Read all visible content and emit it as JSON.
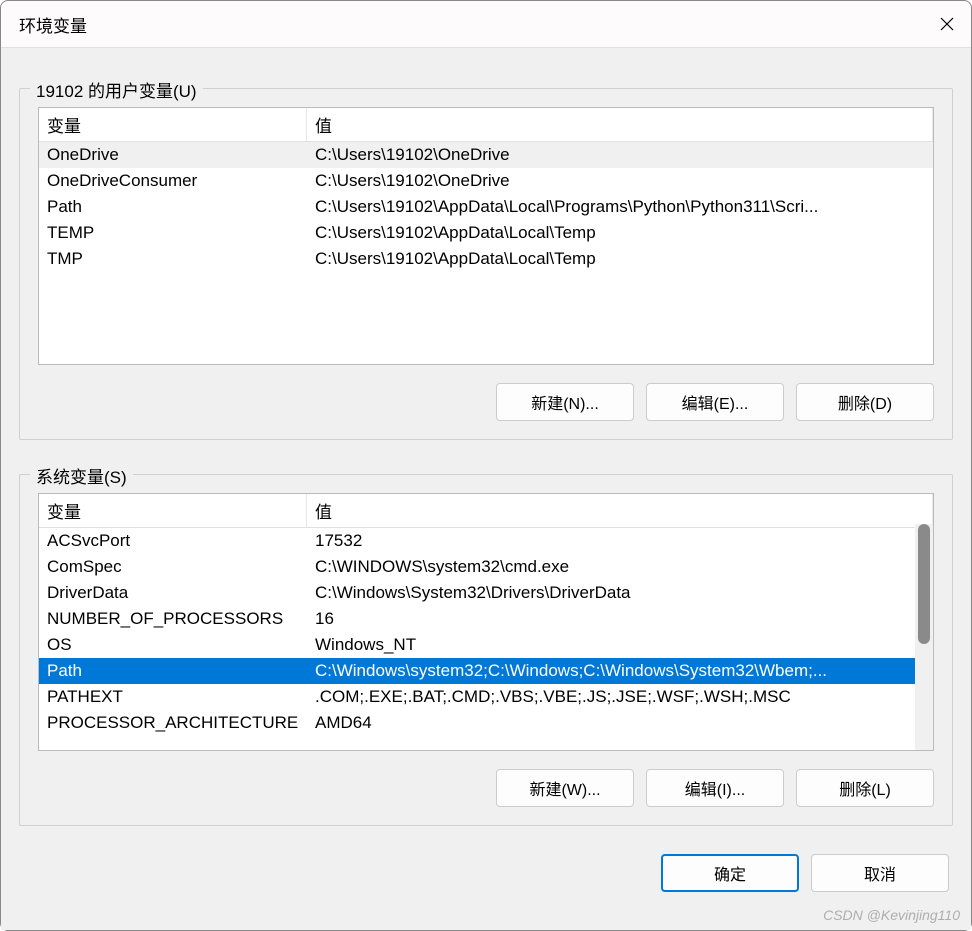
{
  "window": {
    "title": "环境变量"
  },
  "user_vars": {
    "group_label": "19102 的用户变量(U)",
    "columns": {
      "name": "变量",
      "value": "值"
    },
    "rows": [
      {
        "name": "OneDrive",
        "value": "C:\\Users\\19102\\OneDrive",
        "selected": "inactive"
      },
      {
        "name": "OneDriveConsumer",
        "value": "C:\\Users\\19102\\OneDrive"
      },
      {
        "name": "Path",
        "value": "C:\\Users\\19102\\AppData\\Local\\Programs\\Python\\Python311\\Scri..."
      },
      {
        "name": "TEMP",
        "value": "C:\\Users\\19102\\AppData\\Local\\Temp"
      },
      {
        "name": "TMP",
        "value": "C:\\Users\\19102\\AppData\\Local\\Temp"
      }
    ],
    "buttons": {
      "new": "新建(N)...",
      "edit": "编辑(E)...",
      "delete": "删除(D)"
    }
  },
  "system_vars": {
    "group_label": "系统变量(S)",
    "columns": {
      "name": "变量",
      "value": "值"
    },
    "rows": [
      {
        "name": "ACSvcPort",
        "value": "17532"
      },
      {
        "name": "ComSpec",
        "value": "C:\\WINDOWS\\system32\\cmd.exe"
      },
      {
        "name": "DriverData",
        "value": "C:\\Windows\\System32\\Drivers\\DriverData"
      },
      {
        "name": "NUMBER_OF_PROCESSORS",
        "value": "16"
      },
      {
        "name": "OS",
        "value": "Windows_NT"
      },
      {
        "name": "Path",
        "value": "C:\\Windows\\system32;C:\\Windows;C:\\Windows\\System32\\Wbem;...",
        "selected": "active"
      },
      {
        "name": "PATHEXT",
        "value": ".COM;.EXE;.BAT;.CMD;.VBS;.VBE;.JS;.JSE;.WSF;.WSH;.MSC"
      },
      {
        "name": "PROCESSOR_ARCHITECTURE",
        "value": "AMD64"
      }
    ],
    "buttons": {
      "new": "新建(W)...",
      "edit": "编辑(I)...",
      "delete": "删除(L)"
    }
  },
  "dialog_buttons": {
    "ok": "确定",
    "cancel": "取消"
  },
  "watermark": "CSDN @Kevinjing110"
}
